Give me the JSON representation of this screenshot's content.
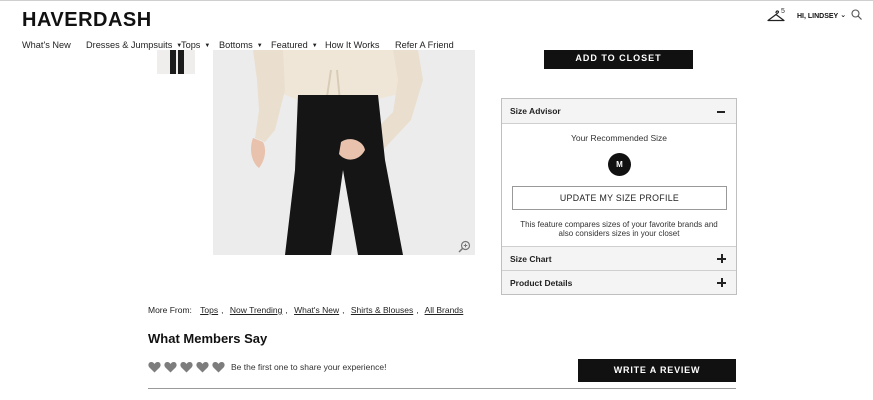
{
  "header": {
    "logo": "HAVERDASH",
    "closet_count": "5",
    "user_greeting": "HI, LINDSEY",
    "icons": [
      "hanger-icon",
      "search-icon",
      "chevron-down-icon"
    ]
  },
  "nav": {
    "items": [
      {
        "label": "What's New",
        "dropdown": false
      },
      {
        "label": "Dresses & Jumpsuits",
        "dropdown": true
      },
      {
        "label": "Tops",
        "dropdown": true
      },
      {
        "label": "Bottoms",
        "dropdown": true
      },
      {
        "label": "Featured",
        "dropdown": true
      },
      {
        "label": "How It Works",
        "dropdown": false
      },
      {
        "label": "Refer A Friend",
        "dropdown": false
      }
    ]
  },
  "product": {
    "add_to_closet_label": "ADD TO CLOSET",
    "zoom_icon": "zoom-in-icon"
  },
  "size_advisor": {
    "title": "Size Advisor",
    "recommended_label": "Your Recommended Size",
    "recommended_size": "M",
    "update_button_label": "UPDATE MY SIZE PROFILE",
    "description": "This feature compares sizes of your favorite brands and also considers sizes in your closet",
    "sections": [
      {
        "label": "Size Chart"
      },
      {
        "label": "Product Details"
      }
    ]
  },
  "more_from": {
    "label": "More From:",
    "links": [
      "Tops",
      "Now Trending",
      "What's New",
      "Shirts & Blouses",
      "All Brands"
    ]
  },
  "reviews": {
    "title": "What Members Say",
    "rating_count": 5,
    "empty_text": "Be the first one to share your experience!",
    "write_button_label": "WRITE A REVIEW"
  },
  "colors": {
    "primary_button": "#111111",
    "panel_header": "#f4f4f4",
    "heart_empty": "#7d7d7d"
  }
}
